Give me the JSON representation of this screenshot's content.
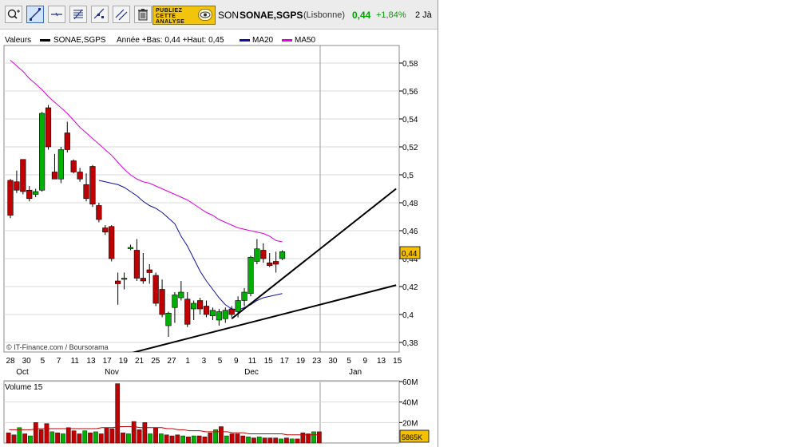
{
  "toolbar": {
    "tools": [
      {
        "name": "zoom-tool",
        "icon": "zoom-plus-icon",
        "label": "Q+"
      },
      {
        "name": "trendline-tool",
        "icon": "trendline-icon",
        "label": ""
      },
      {
        "name": "horizontal-line-tool",
        "icon": "horizontal-line-icon",
        "label": ""
      },
      {
        "name": "fibonacci-tool",
        "icon": "fibonacci-icon",
        "label": ""
      },
      {
        "name": "channel-tool",
        "icon": "channel-icon",
        "label": ""
      },
      {
        "name": "parallel-tool",
        "icon": "parallel-lines-icon",
        "label": ""
      },
      {
        "name": "delete-tool",
        "icon": "trash-icon",
        "label": ""
      }
    ],
    "ad_lines": [
      "PUBLIEZ",
      "CETTE",
      "ANALYSE"
    ],
    "ticker_short": "SON",
    "ticker_name": "SONAE,SGPS",
    "exchange": "(Lisbonne)",
    "price": "0,44",
    "change": "+1,84%",
    "period": "2 Jà"
  },
  "legend": {
    "valeurs": "Valeurs",
    "series": "SONAE,SGPS",
    "stats": "Année +Bas: 0,44 +Haut: 0,45",
    "ma20": "MA20",
    "ma50": "MA50"
  },
  "colors": {
    "up": "#00b000",
    "down": "#c00000",
    "ma20": "#1010a0",
    "ma50": "#dd00dd",
    "price_tag": "#f5c000",
    "grid": "#d8d8d8"
  },
  "chart_data": [
    {
      "type": "candlestick",
      "title": "SONAE,SGPS",
      "ylim": [
        0.37,
        0.59
      ],
      "y_ticks": [
        "0,38",
        "0,4",
        "0,42",
        "0,44",
        "0,46",
        "0,48",
        "0,5",
        "0,52",
        "0,54",
        "0,56",
        "0,58"
      ],
      "x_day_labels": [
        "28",
        "30",
        "5",
        "7",
        "11",
        "13",
        "17",
        "19",
        "21",
        "25",
        "27",
        "1",
        "3",
        "5",
        "9",
        "11",
        "15",
        "17",
        "19",
        "23",
        "30",
        "5",
        "9",
        "13",
        "15"
      ],
      "x_month_labels": [
        "Oct",
        "Nov",
        "Dec",
        "Jan"
      ],
      "last_price_label": "0,44",
      "watermark": "© IT-Finance.com / Boursorama",
      "candles": [
        {
          "o": 0.496,
          "h": 0.497,
          "l": 0.469,
          "c": 0.471
        },
        {
          "o": 0.495,
          "h": 0.503,
          "l": 0.487,
          "c": 0.489
        },
        {
          "o": 0.511,
          "h": 0.511,
          "l": 0.486,
          "c": 0.488
        },
        {
          "o": 0.489,
          "h": 0.492,
          "l": 0.481,
          "c": 0.483
        },
        {
          "o": 0.486,
          "h": 0.49,
          "l": 0.484,
          "c": 0.488
        },
        {
          "o": 0.489,
          "h": 0.545,
          "l": 0.488,
          "c": 0.544
        },
        {
          "o": 0.548,
          "h": 0.55,
          "l": 0.518,
          "c": 0.52
        },
        {
          "o": 0.502,
          "h": 0.515,
          "l": 0.497,
          "c": 0.497
        },
        {
          "o": 0.497,
          "h": 0.52,
          "l": 0.494,
          "c": 0.518
        },
        {
          "o": 0.53,
          "h": 0.538,
          "l": 0.516,
          "c": 0.518
        },
        {
          "o": 0.51,
          "h": 0.511,
          "l": 0.501,
          "c": 0.502
        },
        {
          "o": 0.502,
          "h": 0.505,
          "l": 0.495,
          "c": 0.497
        },
        {
          "o": 0.493,
          "h": 0.501,
          "l": 0.481,
          "c": 0.483
        },
        {
          "o": 0.506,
          "h": 0.507,
          "l": 0.477,
          "c": 0.479
        },
        {
          "o": 0.478,
          "h": 0.48,
          "l": 0.466,
          "c": 0.468
        },
        {
          "o": 0.462,
          "h": 0.464,
          "l": 0.457,
          "c": 0.459
        },
        {
          "o": 0.463,
          "h": 0.464,
          "l": 0.438,
          "c": 0.44
        },
        {
          "o": 0.424,
          "h": 0.43,
          "l": 0.407,
          "c": 0.422
        },
        {
          "o": 0.426,
          "h": 0.43,
          "l": 0.418,
          "c": 0.426
        },
        {
          "o": 0.448,
          "h": 0.45,
          "l": 0.446,
          "c": 0.448
        },
        {
          "o": 0.446,
          "h": 0.454,
          "l": 0.424,
          "c": 0.426
        },
        {
          "o": 0.426,
          "h": 0.444,
          "l": 0.422,
          "c": 0.424
        },
        {
          "o": 0.432,
          "h": 0.436,
          "l": 0.422,
          "c": 0.43
        },
        {
          "o": 0.428,
          "h": 0.43,
          "l": 0.406,
          "c": 0.408
        },
        {
          "o": 0.418,
          "h": 0.425,
          "l": 0.398,
          "c": 0.4
        },
        {
          "o": 0.392,
          "h": 0.402,
          "l": 0.384,
          "c": 0.401
        },
        {
          "o": 0.405,
          "h": 0.416,
          "l": 0.394,
          "c": 0.414
        },
        {
          "o": 0.412,
          "h": 0.424,
          "l": 0.41,
          "c": 0.416
        },
        {
          "o": 0.411,
          "h": 0.416,
          "l": 0.391,
          "c": 0.393
        },
        {
          "o": 0.404,
          "h": 0.41,
          "l": 0.396,
          "c": 0.408
        },
        {
          "o": 0.41,
          "h": 0.412,
          "l": 0.4,
          "c": 0.404
        },
        {
          "o": 0.406,
          "h": 0.41,
          "l": 0.398,
          "c": 0.4
        },
        {
          "o": 0.399,
          "h": 0.405,
          "l": 0.396,
          "c": 0.403
        },
        {
          "o": 0.396,
          "h": 0.404,
          "l": 0.392,
          "c": 0.402
        },
        {
          "o": 0.397,
          "h": 0.405,
          "l": 0.394,
          "c": 0.403
        },
        {
          "o": 0.404,
          "h": 0.406,
          "l": 0.398,
          "c": 0.4
        },
        {
          "o": 0.402,
          "h": 0.413,
          "l": 0.398,
          "c": 0.41
        },
        {
          "o": 0.41,
          "h": 0.419,
          "l": 0.406,
          "c": 0.416
        },
        {
          "o": 0.415,
          "h": 0.442,
          "l": 0.413,
          "c": 0.441
        },
        {
          "o": 0.438,
          "h": 0.454,
          "l": 0.436,
          "c": 0.447
        },
        {
          "o": 0.446,
          "h": 0.451,
          "l": 0.437,
          "c": 0.44
        },
        {
          "o": 0.437,
          "h": 0.444,
          "l": 0.434,
          "c": 0.435
        },
        {
          "o": 0.438,
          "h": 0.445,
          "l": 0.43,
          "c": 0.436
        },
        {
          "o": 0.44,
          "h": 0.446,
          "l": 0.439,
          "c": 0.445
        }
      ],
      "ma20": [
        0.496,
        0.495,
        0.494,
        0.493,
        0.491,
        0.488,
        0.485,
        0.481,
        0.478,
        0.476,
        0.473,
        0.469,
        0.465,
        0.456,
        0.449,
        0.44,
        0.431,
        0.424,
        0.418,
        0.412,
        0.407,
        0.404,
        0.403,
        0.405,
        0.407,
        0.41,
        0.412,
        0.413,
        0.414,
        0.415
      ],
      "ma50": [
        0.582,
        0.578,
        0.574,
        0.569,
        0.565,
        0.561,
        0.556,
        0.552,
        0.548,
        0.544,
        0.539,
        0.534,
        0.53,
        0.526,
        0.522,
        0.518,
        0.514,
        0.509,
        0.504,
        0.5,
        0.497,
        0.495,
        0.494,
        0.492,
        0.49,
        0.488,
        0.486,
        0.484,
        0.482,
        0.479,
        0.476,
        0.473,
        0.471,
        0.468,
        0.466,
        0.464,
        0.462,
        0.461,
        0.46,
        0.459,
        0.458,
        0.456,
        0.453,
        0.452
      ],
      "trendlines": [
        {
          "from": {
            "index": 17.0,
            "value": 0.37
          },
          "to": {
            "index": 61.0,
            "value": 0.421
          }
        },
        {
          "from": {
            "index": 35.0,
            "value": 0.397
          },
          "to": {
            "index": 61.0,
            "value": 0.49
          }
        }
      ]
    },
    {
      "type": "bar",
      "title": "Volume 15",
      "ylim": [
        0,
        60
      ],
      "unit": "M",
      "y_ticks": [
        "20M",
        "40M",
        "60M"
      ],
      "last_value_label": "5865K",
      "values": [
        10,
        8,
        15,
        9,
        7,
        20,
        13,
        19,
        11,
        10,
        9,
        15,
        12,
        9,
        12,
        10,
        11,
        9,
        15,
        14,
        58,
        10,
        9,
        21,
        13,
        20,
        9,
        15,
        9,
        8,
        7,
        8,
        7,
        6,
        7,
        7,
        6,
        10,
        13,
        16,
        7,
        9,
        9,
        7,
        6,
        5,
        6,
        5,
        5,
        5,
        4,
        5,
        4,
        4,
        10,
        9,
        11,
        11
      ],
      "ma_values": [
        13,
        13,
        13,
        13,
        13,
        14,
        14,
        14,
        14,
        14,
        14,
        14,
        14,
        14,
        14,
        14,
        14,
        15,
        15,
        15,
        16,
        16,
        16,
        16,
        15,
        15,
        15,
        15,
        15,
        14,
        14,
        13,
        13,
        12,
        12,
        12,
        11,
        11,
        11,
        11,
        11,
        10,
        10,
        10,
        9,
        9,
        9,
        9,
        9,
        9,
        9,
        8,
        8,
        8,
        8,
        8,
        8,
        8
      ]
    }
  ]
}
